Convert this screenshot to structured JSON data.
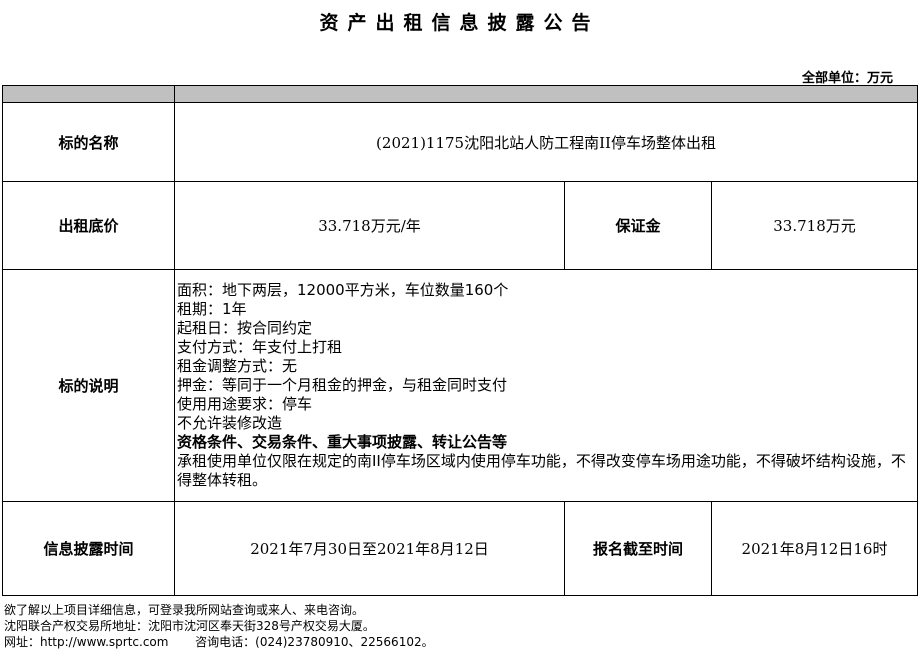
{
  "title": "资产出租信息披露公告",
  "unit": "全部单位：万元",
  "rows": {
    "name_label": "标的名称",
    "name_value": "(2021)1175沈阳北站人防工程南II停车场整体出租",
    "price_label": "出租底价",
    "price_value": "33.718万元/年",
    "deposit_label": "保证金",
    "deposit_value": "33.718万元",
    "desc_label": "标的说明",
    "desc_lines": [
      "面积：地下两层，12000平方米，车位数量160个",
      "租期：1年",
      "起租日：按合同约定",
      "支付方式：年支付上打租",
      "租金调整方式：无",
      "押金：等同于一个月租金的押金，与租金同时支付",
      "使用用途要求：停车",
      "不允许装修改造"
    ],
    "desc_bold": "资格条件、交易条件、重大事项披露、转让公告等",
    "desc_tail": "承租使用单位仅限在规定的南II停车场区域内使用停车功能，不得改变停车场用途功能，不得破坏结构设施，不得整体转租。",
    "period_label": "信息披露时间",
    "period_value": "2021年7月30日至2021年8月12日",
    "deadline_label": "报名截至时间",
    "deadline_value": "2021年8月12日16时"
  },
  "footer": {
    "line1": "欲了解以上项目详细信息，可登录我所网站查询或来人、来电咨询。",
    "line2": "沈阳联合产权交易所地址：沈阳市沈河区奉天街328号产权交易大厦。",
    "line3": "网址：http://www.sprtc.com       咨询电话：(024)23780910、22566102。"
  }
}
